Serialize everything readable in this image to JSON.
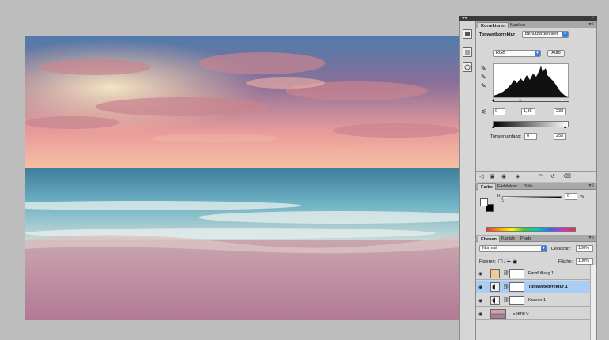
{
  "adjustments": {
    "tabs": [
      "Korrekturen",
      "Masken"
    ],
    "title": "Tonwertkorrektur",
    "preset": "Benutzerdefiniert",
    "channel": "RGB",
    "auto_label": "Auto",
    "input_black": "0",
    "input_gamma": "1,36",
    "input_white": "238",
    "output_label": "Tonwertumfang:",
    "output_black": "0",
    "output_white": "255"
  },
  "color": {
    "tabs": [
      "Farbe",
      "Farbfelder",
      "Stile"
    ],
    "k_label": "K",
    "k_value": "0",
    "percent": "%"
  },
  "layers": {
    "tabs": [
      "Ebenen",
      "Kanäle",
      "Pfade"
    ],
    "blend_mode": "Normal",
    "opacity_label": "Deckkraft:",
    "opacity": "100%",
    "lock_label": "Fixieren:",
    "fill_label": "Fläche:",
    "fill": "100%",
    "items": [
      {
        "name": "Farbfüllung 1",
        "selected": false
      },
      {
        "name": "Tonwertkorrektur 1",
        "selected": true
      },
      {
        "name": "Kurven 1",
        "selected": false
      },
      {
        "name": "Ebene 0",
        "selected": false
      }
    ]
  },
  "colors": {
    "selection": "#a9cdf3",
    "accent": "#3b7ddd",
    "fill_swatch": "#f5c995"
  },
  "icons": [
    "adjustments-icon",
    "history-icon",
    "info-icon",
    "eyedropper-icon",
    "eye-icon",
    "lock-icon",
    "chain-icon"
  ]
}
